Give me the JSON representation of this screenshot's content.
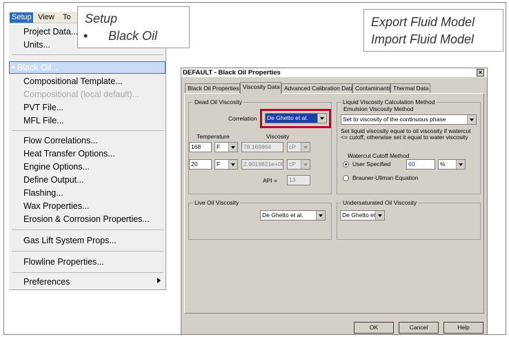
{
  "menubar": {
    "items": [
      "Setup",
      "View",
      "To"
    ]
  },
  "menu": {
    "items": [
      {
        "label": "Project Data..."
      },
      {
        "label": "Units..."
      },
      {
        "label": "Black Oil..."
      },
      {
        "label": "Compositional Template..."
      },
      {
        "label": "Compositional (local default)..."
      },
      {
        "label": "PVT File..."
      },
      {
        "label": "MFL File..."
      },
      {
        "label": "Flow Correlations..."
      },
      {
        "label": "Heat Transfer Options..."
      },
      {
        "label": "Engine Options..."
      },
      {
        "label": "Define Output..."
      },
      {
        "label": "Flashing..."
      },
      {
        "label": "Wax Properties..."
      },
      {
        "label": "Erosion & Corrosion Properties..."
      },
      {
        "label": "Gas Lift System Props..."
      },
      {
        "label": "Flowline Properties..."
      },
      {
        "label": "Preferences"
      }
    ]
  },
  "callouts": {
    "setup_title": "Setup",
    "bullet": "•",
    "setup_item": "Black Oil",
    "export": "Export Fluid Model",
    "import": "Import Fluid Model"
  },
  "dialog": {
    "title": "DEFAULT - Black Oil Properties",
    "close": "×",
    "tabs": [
      "Black Oil Properties",
      "Viscosity Data",
      "Advanced Calibration Data",
      "Contaminants",
      "Thermal Data"
    ],
    "dead_oil": {
      "group": "Dead Oil Viscosity",
      "correlation_label": "Correlation",
      "correlation_value": "De Ghetto et al.",
      "temperature_header": "Temperature",
      "viscosity_header": "Viscosity",
      "rows": [
        {
          "temp": "168",
          "temp_unit": "F",
          "visc": "78.169864",
          "visc_unit": "cP"
        },
        {
          "temp": "20",
          "temp_unit": "F",
          "visc": "2.9019821e+008",
          "visc_unit": "cP"
        }
      ],
      "api_label": "API =",
      "api_value": "13"
    },
    "liquid_method": {
      "group": "Liquid Viscosity Calculation Method",
      "emulsion_label": "Emulsion Viscosity Method",
      "emulsion_value": "Set to viscosity of the continuous phase",
      "note": "Set liquid viscosity equal to oil viscosity if watercut <= cutoff, otherwise set it equal to water viscosity",
      "cutoff_label": "Watercut Cutoff Method",
      "user_specified": "User Specified",
      "cutoff_value": "60",
      "cutoff_unit": "%",
      "brauner": "Brauner-Ullman Equation"
    },
    "live_oil": {
      "group": "Live Oil Viscosity",
      "value": "De Ghetto et al."
    },
    "undersaturated": {
      "group": "Undersaturated Oil Viscosity",
      "value": "De Ghetto et al."
    },
    "buttons": {
      "ok": "OK",
      "cancel": "Cancel",
      "help": "Help"
    }
  }
}
